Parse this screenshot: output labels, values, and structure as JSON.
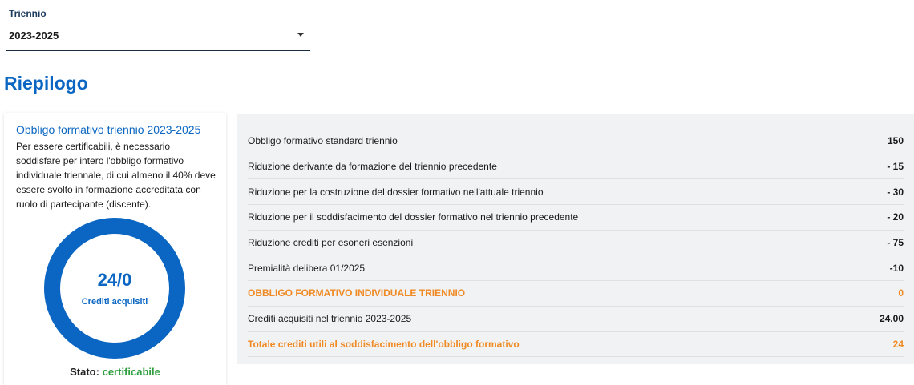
{
  "triennio_select": {
    "label": "Triennio",
    "value": "2023-2025"
  },
  "page": {
    "title": "Riepilogo"
  },
  "summary_card": {
    "title": "Obbligo formativo triennio 2023-2025",
    "description": "Per essere certificabili, è necessario soddisfare per intero l'obbligo formativo individuale triennale, di cui almeno il 40% deve essere svolto in formazione accreditata con ruolo di partecipante (discente).",
    "donut_value": "24/0",
    "donut_caption": "Crediti acquisiti",
    "donut_progress": 1.0,
    "status_label": "Stato:",
    "status_value": "certificabile"
  },
  "colors": {
    "accent": "#0a66c2",
    "highlight": "#f08a24",
    "success": "#2e9e3e",
    "panel": "#f1f2f4"
  },
  "rows": [
    {
      "label": "Obbligo formativo standard triennio",
      "value": "150",
      "highlight": false
    },
    {
      "label": "Riduzione derivante da formazione del triennio precedente",
      "value": "- 15",
      "highlight": false
    },
    {
      "label": "Riduzione per la costruzione del dossier formativo nell'attuale triennio",
      "value": "- 30",
      "highlight": false
    },
    {
      "label": "Riduzione per il soddisfacimento del dossier formativo nel triennio precedente",
      "value": "- 20",
      "highlight": false
    },
    {
      "label": "Riduzione crediti per esoneri esenzioni",
      "value": "- 75",
      "highlight": false
    },
    {
      "label": "Premialità delibera 01/2025",
      "value": "-10",
      "highlight": false
    },
    {
      "label": "OBBLIGO FORMATIVO INDIVIDUALE TRIENNIO",
      "value": "0",
      "highlight": true
    },
    {
      "label": "Crediti acquisiti nel triennio 2023-2025",
      "value": "24.00",
      "highlight": false
    },
    {
      "label": "Totale crediti utili al soddisfacimento dell'obbligo formativo",
      "value": "24",
      "highlight": true
    }
  ]
}
